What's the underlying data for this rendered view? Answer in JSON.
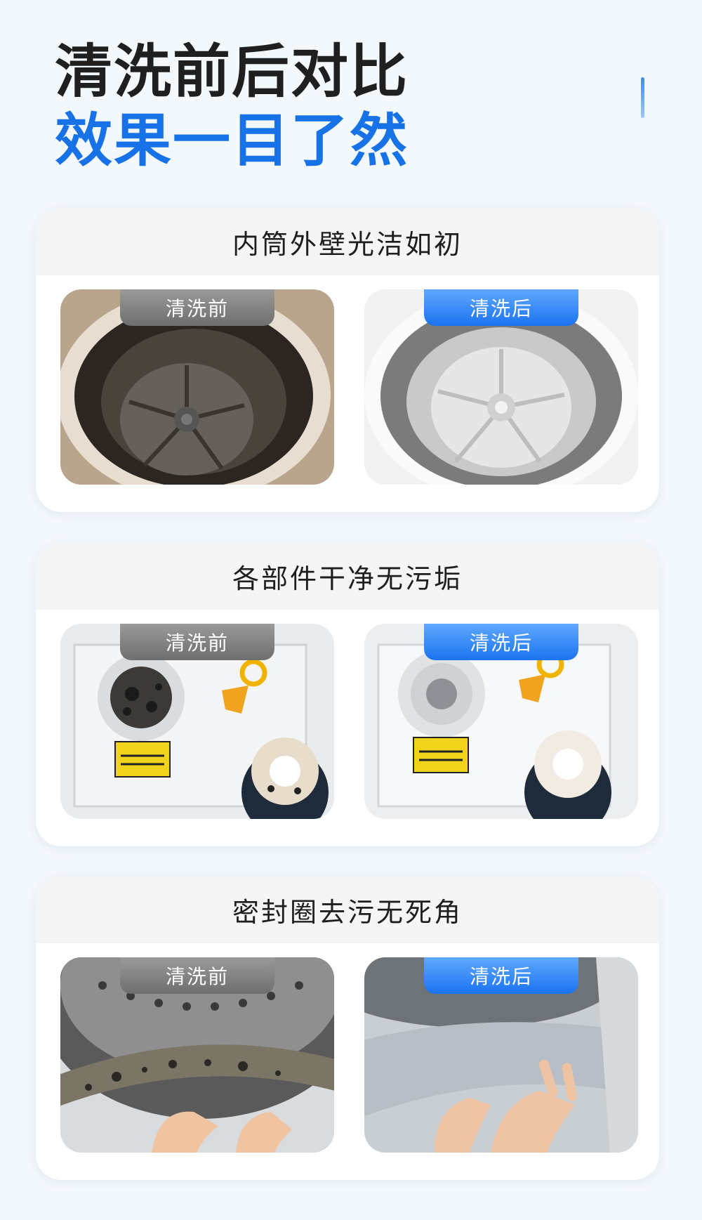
{
  "heading": {
    "line1": "清洗前后对比",
    "line2": "效果一目了然"
  },
  "colors": {
    "accent": "#1672e6",
    "before_badge": "#7f7f7f",
    "after_badge": "#2a80f2"
  },
  "badges": {
    "before": "清洗前",
    "after": "清洗后"
  },
  "cards": [
    {
      "title": "内筒外壁光洁如初"
    },
    {
      "title": "各部件干净无污垢"
    },
    {
      "title": "密封圈去污无死角"
    }
  ]
}
